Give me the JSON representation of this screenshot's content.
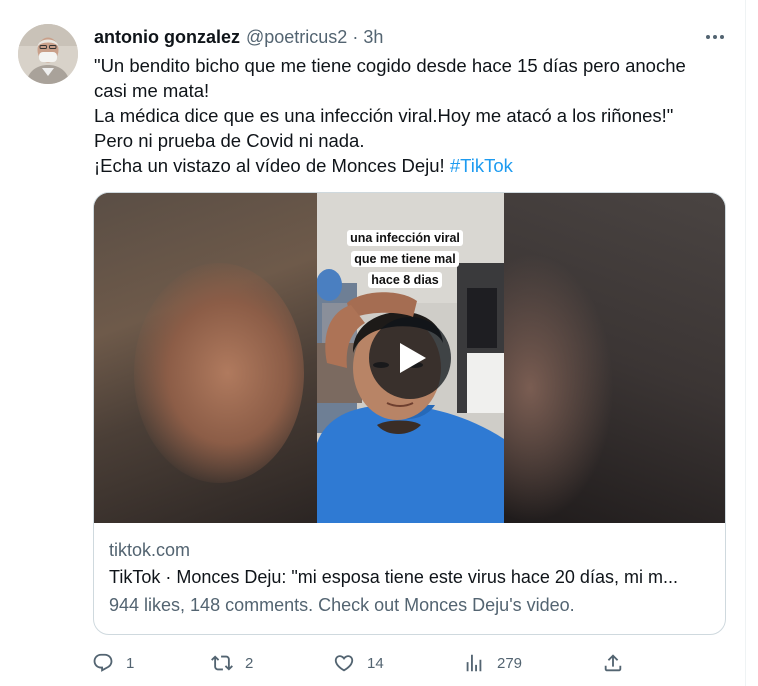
{
  "tweet": {
    "author_name": "antonio gonzalez",
    "handle": "@poetricus2",
    "separator": "·",
    "time": "3h",
    "lines": [
      "\"Un bendito bicho que me tiene cogido desde hace 15 días pero anoche",
      "casi me mata!",
      "La médica dice que es una infección viral.Hoy me atacó a los riñones!\"",
      "Pero ni prueba de Covid ni nada."
    ],
    "last_line_text": "¡Echa un vistazo al vídeo de Monces Deju! ",
    "hashtag": "#TikTok"
  },
  "card": {
    "video_overlay_lines": [
      "una infección viral",
      "que me tiene mal",
      "hace 8 dias"
    ],
    "domain": "tiktok.com",
    "title": "TikTok · Monces Deju: \"mi esposa tiene este virus hace 20 días, mi m...",
    "description": "944 likes, 148 comments. Check out Monces Deju's video."
  },
  "actions": {
    "reply_count": "1",
    "retweet_count": "2",
    "like_count": "14",
    "views_count": "279"
  },
  "icons": {
    "more": "more-icon",
    "play": "play-icon",
    "reply": "reply-icon",
    "retweet": "retweet-icon",
    "like": "heart-icon",
    "views": "views-icon",
    "share": "share-icon"
  },
  "colors": {
    "text": "#0f1419",
    "secondary": "#536471",
    "link": "#1d9bf0",
    "border": "#cfd9de"
  }
}
